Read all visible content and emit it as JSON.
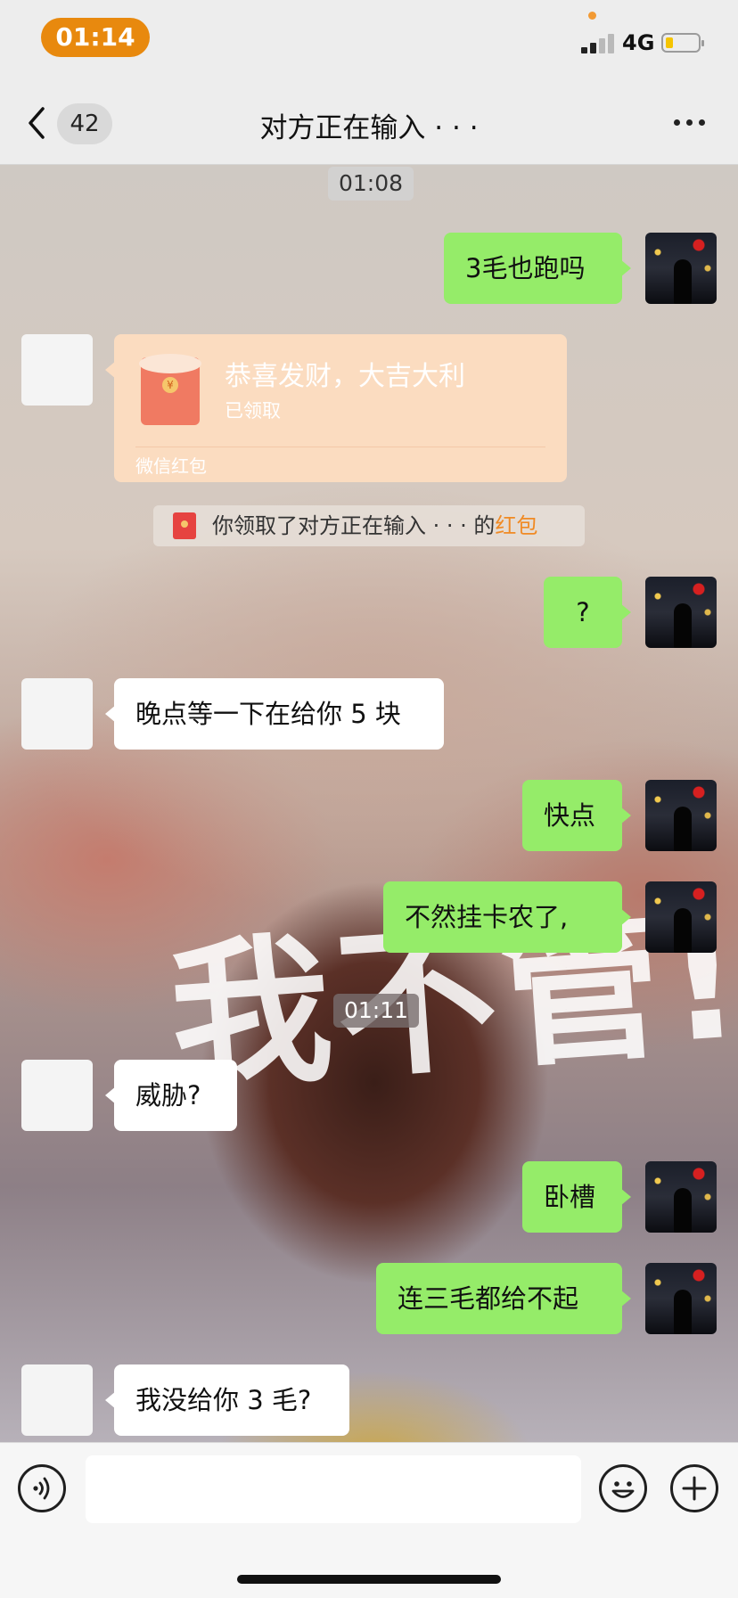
{
  "status_bar": {
    "time": "01:14",
    "network": "4G",
    "battery_color": "#f5c400"
  },
  "nav": {
    "unread_count": "42",
    "title": "对方正在输入 · · ·"
  },
  "chat": {
    "background_caption": "我不管!",
    "timestamps": [
      "01:08",
      "01:11"
    ],
    "messages": [
      {
        "from": "me",
        "text": "3毛也跑吗"
      },
      {
        "from": "other",
        "type": "red_packet",
        "title": "恭喜发财，大吉大利",
        "status": "已领取",
        "footer": "微信红包"
      },
      {
        "type": "system",
        "text": "你领取了对方正在输入 · · · 的",
        "link": "红包"
      },
      {
        "from": "me",
        "text": "?"
      },
      {
        "from": "other",
        "text": "晚点等一下在给你 5 块"
      },
      {
        "from": "me",
        "text": "快点"
      },
      {
        "from": "me",
        "text": "不然挂卡农了,"
      },
      {
        "from": "other",
        "text": "威胁?"
      },
      {
        "from": "me",
        "text": "卧槽"
      },
      {
        "from": "me",
        "text": "连三毛都给不起"
      },
      {
        "from": "other",
        "text": "我没给你 3 毛?"
      }
    ]
  },
  "input_bar": {
    "voice_icon": "voice-icon",
    "emoji_icon": "emoji-icon",
    "plus_icon": "plus-icon",
    "placeholder": ""
  },
  "colors": {
    "my_bubble": "#95ec69",
    "other_bubble": "#ffffff",
    "status_pill": "#e8890e",
    "red_packet": "#fbdcc0",
    "link": "#f08a24"
  }
}
